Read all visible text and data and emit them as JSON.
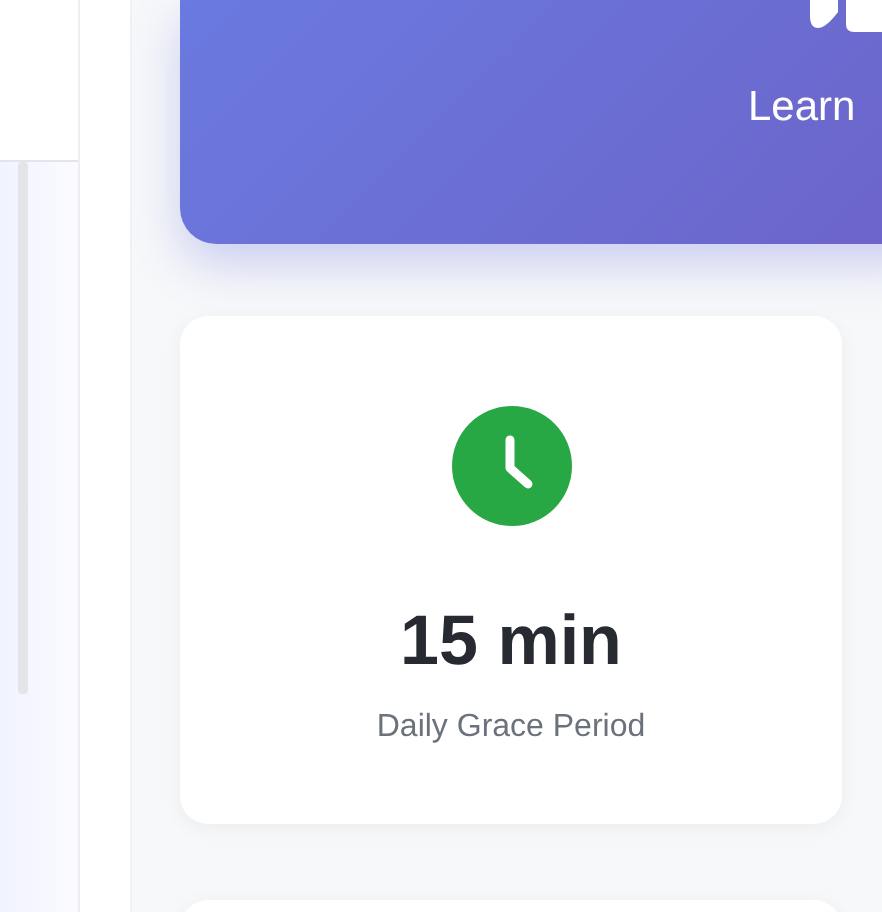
{
  "banner": {
    "link": "Learn"
  },
  "stat_card": {
    "value": "15 min",
    "label": "Daily Grace Period"
  }
}
